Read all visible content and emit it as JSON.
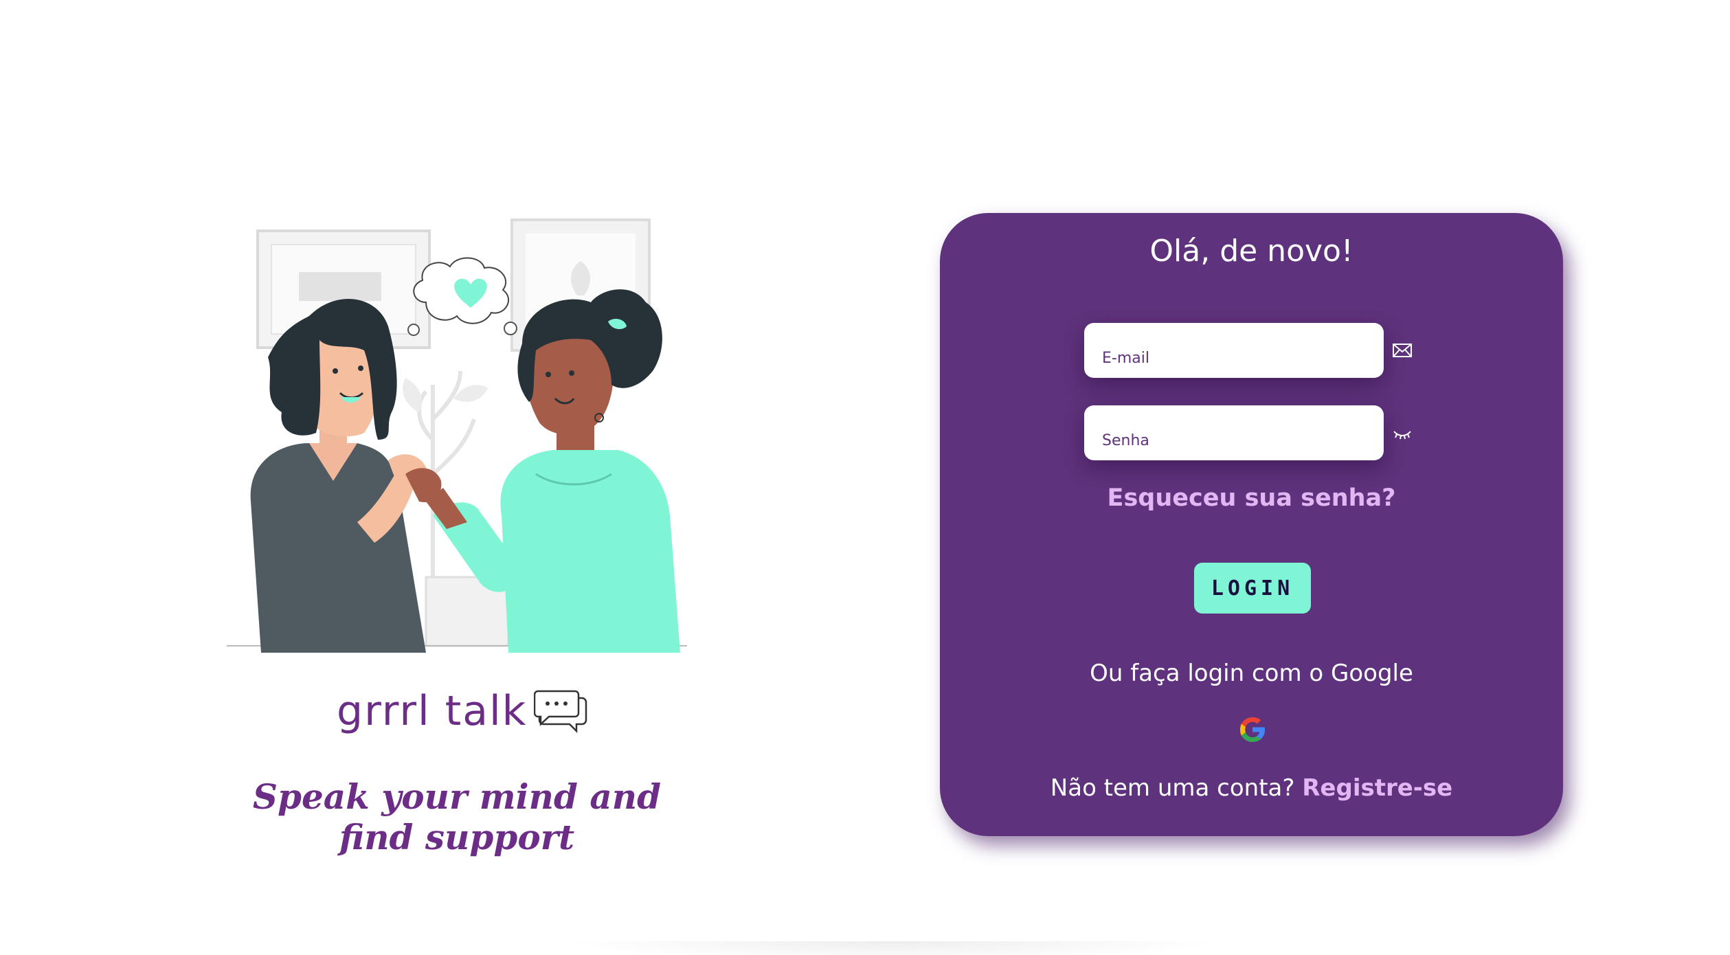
{
  "brand": {
    "name": "grrrl talk",
    "icon": "chat-bubbles-icon",
    "tagline": "Speak your mind and find support"
  },
  "illustration": {
    "name": "two-women-pinky-promise-illustration"
  },
  "login_card": {
    "title": "Olá, de novo!",
    "email_placeholder": "E-mail",
    "email_icon": "envelope-icon",
    "password_placeholder": "Senha",
    "password_icon": "eye-closed-icon",
    "forgot_password": "Esqueceu sua senha?",
    "login_button": "LOGIN",
    "google_text": "Ou faça login com o Google",
    "google_icon": "google-icon",
    "register_prompt": "Não tem uma conta?",
    "register_link": "Registre-se"
  },
  "colors": {
    "card_background": "#5e327c",
    "accent_mint": "#7ff5d6",
    "link_lilac": "#e2b6f2",
    "brand_purple": "#6b2d86"
  }
}
